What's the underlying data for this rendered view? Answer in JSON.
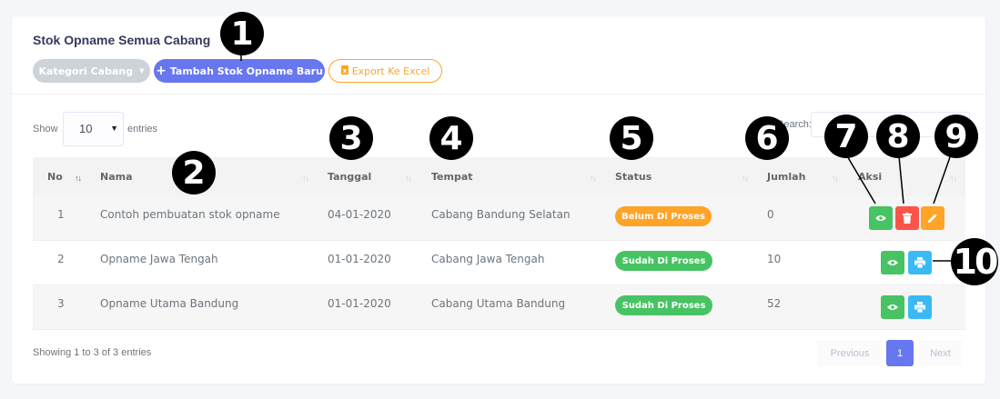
{
  "card": {
    "title": "Stok Opname Semua Cabang"
  },
  "toolbar": {
    "kategori_label": "Kategori Cabang",
    "tambah_label": "Tambah Stok Opname Baru",
    "export_label": "Export Ke Excel"
  },
  "length": {
    "show_label": "Show",
    "value": "10",
    "entries_label": "entries"
  },
  "search": {
    "label": "Search:"
  },
  "columns": [
    "No",
    "Nama",
    "Tanggal",
    "Tempat",
    "Status",
    "Jumlah",
    "Aksi"
  ],
  "rows": [
    {
      "no": "1",
      "nama": "Contoh pembuatan stok opname",
      "tanggal": "04-01-2020",
      "tempat": "Cabang Bandung Selatan",
      "status": "Belum Di Proses",
      "jumlah": "0"
    },
    {
      "no": "2",
      "nama": "Opname Jawa Tengah",
      "tanggal": "01-01-2020",
      "tempat": "Cabang Jawa Tengah",
      "status": "Sudah Di Proses",
      "jumlah": "10"
    },
    {
      "no": "3",
      "nama": "Opname Utama Bandung",
      "tanggal": "01-01-2020",
      "tempat": "Cabang Utama Bandung",
      "status": "Sudah Di Proses",
      "jumlah": "52"
    }
  ],
  "footer": {
    "info": "Showing 1 to 3 of 3 entries"
  },
  "pagination": {
    "previous": "Previous",
    "page": "1",
    "next": "Next"
  },
  "markers": [
    "1",
    "2",
    "3",
    "4",
    "5",
    "6",
    "7",
    "8",
    "9",
    "10"
  ],
  "colors": {
    "primary": "#6777ef",
    "success": "#47c363",
    "danger": "#fc544b",
    "warning": "#ffa426",
    "info": "#3abaf4"
  }
}
